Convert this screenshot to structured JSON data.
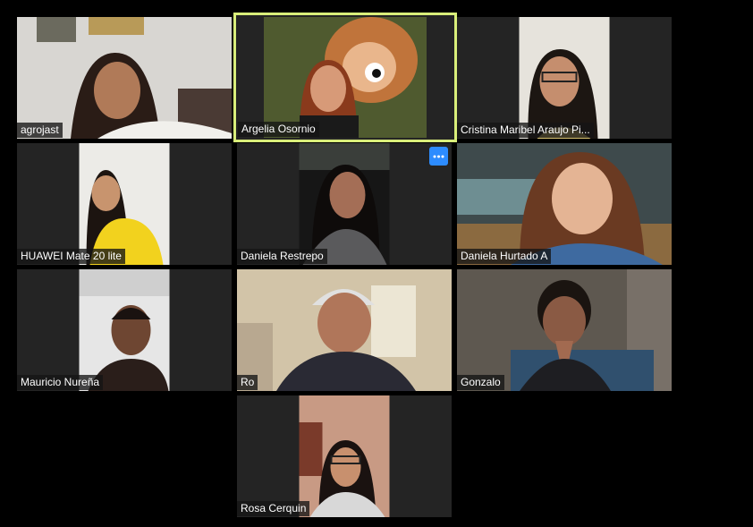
{
  "participants": [
    {
      "name": "agrojast"
    },
    {
      "name": "Argelia Osornio",
      "speaking": true
    },
    {
      "name": "Cristina Maribel Araujo Pi..."
    },
    {
      "name": "HUAWEI Mate 20 lite"
    },
    {
      "name": "Daniela Restrepo",
      "menu_icon": "more-options-icon"
    },
    {
      "name": "Daniela Hurtado A"
    },
    {
      "name": "Mauricio Nureña"
    },
    {
      "name": "Ro"
    },
    {
      "name": "Gonzalo"
    },
    {
      "name": "Rosa Cerquin"
    }
  ],
  "colors": {
    "background": "#000000",
    "tile": "#242424",
    "active_speaker_border": "#d9ee7a",
    "menu_button": "#2d8cff"
  }
}
